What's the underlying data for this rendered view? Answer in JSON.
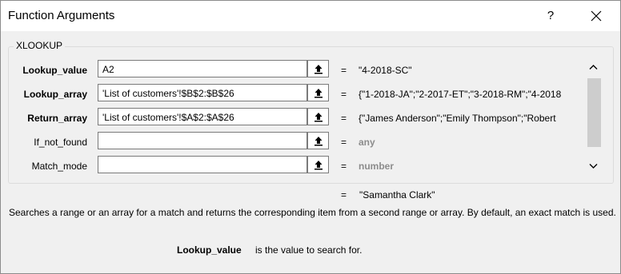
{
  "window": {
    "title": "Function Arguments",
    "help_label": "?"
  },
  "function": {
    "name": "XLOOKUP"
  },
  "arguments": [
    {
      "label": "Lookup_value",
      "bold": true,
      "value": "A2",
      "result": "\"4-2018-SC\"",
      "result_gray": false
    },
    {
      "label": "Lookup_array",
      "bold": true,
      "value": "'List of customers'!$B$2:$B$26",
      "result": "{\"1-2018-JA\";\"2-2017-ET\";\"3-2018-RM\";\"4-2018",
      "result_gray": false
    },
    {
      "label": "Return_array",
      "bold": true,
      "value": "'List of customers'!$A$2:$A$26",
      "result": "{\"James Anderson\";\"Emily Thompson\";\"Robert",
      "result_gray": false
    },
    {
      "label": "If_not_found",
      "bold": false,
      "value": "",
      "result": "any",
      "result_gray": true
    },
    {
      "label": "Match_mode",
      "bold": false,
      "value": "",
      "result": "number",
      "result_gray": true
    }
  ],
  "equals_sign": "=",
  "formula_result": "\"Samantha Clark\"",
  "description": "Searches a range or an array for a match and returns the corresponding item from a second range or array. By default, an exact match is used.",
  "help_param": {
    "name": "Lookup_value",
    "text": "is the value to search for."
  },
  "icons": {
    "close": "close-icon",
    "ref": "collapse-dialog-icon",
    "scroll_up": "chevron-up-icon",
    "scroll_down": "chevron-down-icon"
  },
  "colors": {
    "gray_text": "#8c8c8c",
    "background": "#f0f0f0"
  }
}
